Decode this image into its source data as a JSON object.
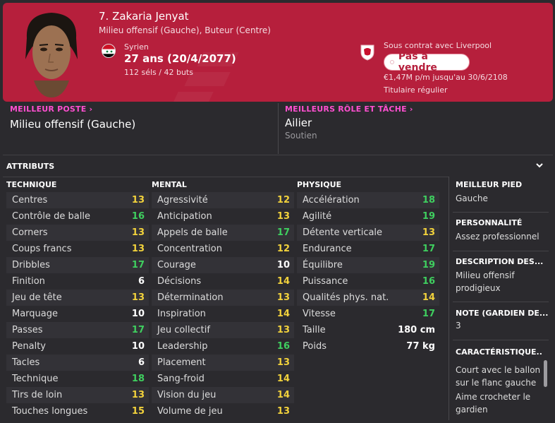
{
  "header": {
    "name": "7. Zakaria Jenyat",
    "positions": "Milieu offensif (Gauche), Buteur (Centre)",
    "nationality": "Syrien",
    "age": "27 ans (20/4/2077)",
    "apps": "112 séls / 42 buts",
    "contract": "Sous contrat avec Liverpool",
    "transfer_status": "Pas à vendre",
    "wage": "€1,47M p/m jusqu'au 30/6/2108",
    "squad_status": "Titulaire régulier",
    "colors": {
      "banner": "#b61f3c",
      "accent": "#ff4fd0",
      "good": "#3fcf5f",
      "ok": "#f2d23c"
    }
  },
  "best_position": {
    "title": "MEILLEUR POSTE",
    "value": "Milieu offensif (Gauche)"
  },
  "best_role": {
    "title": "MEILLEURS RÔLE ET TÂCHE",
    "value": "Ailier",
    "duty": "Soutien"
  },
  "attributes": {
    "title": "ATTRIBUTS",
    "technical": {
      "title": "TECHNIQUE",
      "items": [
        {
          "label": "Centres",
          "value": "13",
          "tone": "y"
        },
        {
          "label": "Contrôle de balle",
          "value": "16",
          "tone": "g"
        },
        {
          "label": "Corners",
          "value": "13",
          "tone": "y"
        },
        {
          "label": "Coups francs",
          "value": "13",
          "tone": "y"
        },
        {
          "label": "Dribbles",
          "value": "17",
          "tone": "g"
        },
        {
          "label": "Finition",
          "value": "6",
          "tone": "w"
        },
        {
          "label": "Jeu de tête",
          "value": "13",
          "tone": "y"
        },
        {
          "label": "Marquage",
          "value": "10",
          "tone": "w"
        },
        {
          "label": "Passes",
          "value": "17",
          "tone": "g"
        },
        {
          "label": "Penalty",
          "value": "10",
          "tone": "w"
        },
        {
          "label": "Tacles",
          "value": "6",
          "tone": "w"
        },
        {
          "label": "Technique",
          "value": "18",
          "tone": "g"
        },
        {
          "label": "Tirs de loin",
          "value": "13",
          "tone": "y"
        },
        {
          "label": "Touches longues",
          "value": "15",
          "tone": "y"
        }
      ]
    },
    "mental": {
      "title": "MENTAL",
      "items": [
        {
          "label": "Agressivité",
          "value": "12",
          "tone": "y"
        },
        {
          "label": "Anticipation",
          "value": "13",
          "tone": "y"
        },
        {
          "label": "Appels de balle",
          "value": "17",
          "tone": "g"
        },
        {
          "label": "Concentration",
          "value": "12",
          "tone": "y"
        },
        {
          "label": "Courage",
          "value": "10",
          "tone": "w"
        },
        {
          "label": "Décisions",
          "value": "14",
          "tone": "y"
        },
        {
          "label": "Détermination",
          "value": "13",
          "tone": "y"
        },
        {
          "label": "Inspiration",
          "value": "14",
          "tone": "y"
        },
        {
          "label": "Jeu collectif",
          "value": "13",
          "tone": "y"
        },
        {
          "label": "Leadership",
          "value": "16",
          "tone": "g"
        },
        {
          "label": "Placement",
          "value": "13",
          "tone": "y"
        },
        {
          "label": "Sang-froid",
          "value": "14",
          "tone": "y"
        },
        {
          "label": "Vision du jeu",
          "value": "14",
          "tone": "y"
        },
        {
          "label": "Volume de jeu",
          "value": "13",
          "tone": "y"
        }
      ]
    },
    "physical": {
      "title": "PHYSIQUE",
      "items": [
        {
          "label": "Accélération",
          "value": "18",
          "tone": "g"
        },
        {
          "label": "Agilité",
          "value": "19",
          "tone": "g"
        },
        {
          "label": "Détente verticale",
          "value": "13",
          "tone": "y"
        },
        {
          "label": "Endurance",
          "value": "17",
          "tone": "g"
        },
        {
          "label": "Équilibre",
          "value": "19",
          "tone": "g"
        },
        {
          "label": "Puissance",
          "value": "16",
          "tone": "g"
        },
        {
          "label": "Qualités phys. nat.",
          "value": "14",
          "tone": "y"
        },
        {
          "label": "Vitesse",
          "value": "17",
          "tone": "g"
        }
      ],
      "height_label": "Taille",
      "height": "180 cm",
      "weight_label": "Poids",
      "weight": "77 kg"
    }
  },
  "side": {
    "foot_title": "MEILLEUR PIED",
    "foot": "Gauche",
    "personality_title": "PERSONNALITÉ",
    "personality": "Assez professionnel",
    "desc_title": "DESCRIPTION DES...",
    "desc": "Milieu offensif prodigieux",
    "note_title": "NOTE (GARDIEN DE...",
    "note": "3",
    "traits_title": "CARACTÉRISTIQUE...",
    "trait1": "Court avec le ballon sur le flanc gauche",
    "trait2": "Aime crocheter le gardien"
  }
}
